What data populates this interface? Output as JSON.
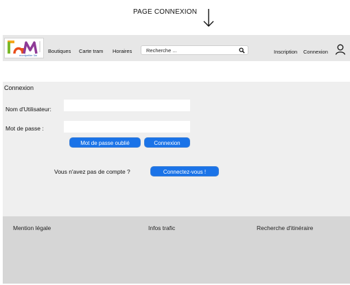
{
  "annotation": {
    "caption": "PAGE CONNEXION",
    "arrow_icon": "arrow-down-icon"
  },
  "header": {
    "logo_text": "TAM",
    "logo_subtitle": "montpellier 3m",
    "nav": [
      "Boutiques",
      "Carte tram",
      "Horaires"
    ],
    "search": {
      "value": "Recherche ..."
    },
    "inscription": "Inscription",
    "connexion": "Connexion",
    "icons": {
      "search": "search-icon",
      "user": "user-icon"
    }
  },
  "login": {
    "title": "Connexion",
    "username_label": "Nom d'Utilisateur:",
    "password_label": "Mot de passe :",
    "forgot_button": "Mot de passe oublié",
    "submit_button": "Connexion",
    "no_account_text": "Vous n'avez pas de compte ?",
    "signup_button": "Connectez-vous !"
  },
  "footer": {
    "links": [
      "Mention légale",
      "Infos trafic",
      "Recherche d'itinéraire"
    ]
  },
  "colors": {
    "primary_button": "#1a73e8",
    "panel_bg": "#efefef",
    "header_bg": "#e7e7e7",
    "footer_bg": "#d6d6d6"
  }
}
